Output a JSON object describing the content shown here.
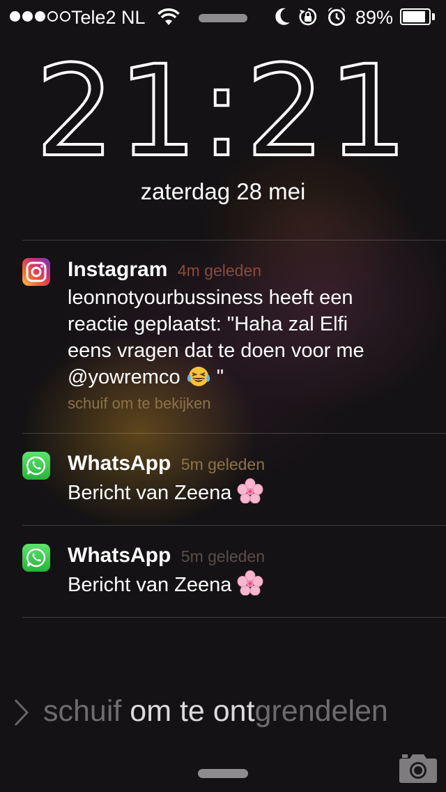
{
  "status_bar": {
    "carrier": "Tele2 NL",
    "signal_strength": 3,
    "signal_max": 5,
    "battery_percent": "89%",
    "battery_level": 0.89,
    "icons": [
      "wifi-icon",
      "moon-icon",
      "rotation-lock-icon",
      "alarm-icon",
      "battery-icon"
    ]
  },
  "lock_screen": {
    "time": "21:21",
    "date": "zaterdag 28 mei",
    "unlock_hint": {
      "part1": "schuif ",
      "part2": "om te ont",
      "part3": "grendelen"
    }
  },
  "notifications": [
    {
      "app": "Instagram",
      "when": "4m geleden",
      "body_lines": [
        "leonnotyourbussiness heeft een",
        "reactie geplaatst: \"Haha zal Elfi",
        "eens vragen dat te doen voor me",
        "@yowremco"
      ],
      "body_tail": "\"",
      "emoji": "face-with-tears-of-joy",
      "action_hint": "schuif om te bekijken"
    },
    {
      "app": "WhatsApp",
      "when": "5m geleden",
      "body": "Bericht van Zeena",
      "emoji": "cherry-blossom"
    },
    {
      "app": "WhatsApp",
      "when": "5m geleden",
      "body": "Bericht van Zeena",
      "emoji": "cherry-blossom"
    }
  ],
  "colors": {
    "background": "#141214",
    "instagram_when": "#8a4a3a",
    "hint_text": "#8b7348",
    "whatsapp_green": "#3dc14f"
  }
}
